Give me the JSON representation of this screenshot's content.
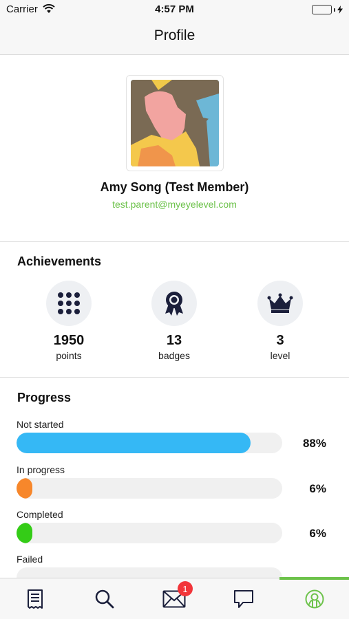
{
  "status_bar": {
    "carrier": "Carrier",
    "time": "4:57 PM"
  },
  "nav": {
    "title": "Profile"
  },
  "profile": {
    "name": "Amy Song (Test Member)",
    "email": "test.parent@myeyelevel.com"
  },
  "achievements": {
    "title": "Achievements",
    "items": [
      {
        "icon": "dots-grid-icon",
        "value": "1950",
        "label": "points"
      },
      {
        "icon": "award-ribbon-icon",
        "value": "13",
        "label": "badges"
      },
      {
        "icon": "crown-icon",
        "value": "3",
        "label": "level"
      }
    ]
  },
  "progress": {
    "title": "Progress",
    "rows": [
      {
        "label": "Not started",
        "percent": "88%",
        "value": 88,
        "color": "#35b8f5"
      },
      {
        "label": "In progress",
        "percent": "6%",
        "value": 6,
        "color": "#f7872b"
      },
      {
        "label": "Completed",
        "percent": "6%",
        "value": 6,
        "color": "#34cc17"
      },
      {
        "label": "Failed",
        "percent": "",
        "value": 0,
        "color": "#e0e0e0"
      }
    ]
  },
  "tab_bar": {
    "tabs": [
      {
        "icon": "receipt-icon"
      },
      {
        "icon": "search-icon"
      },
      {
        "icon": "mail-icon",
        "badge": "1"
      },
      {
        "icon": "chat-bubble-icon"
      },
      {
        "icon": "profile-icon",
        "active": true
      }
    ],
    "accent": "#6cc24a"
  }
}
